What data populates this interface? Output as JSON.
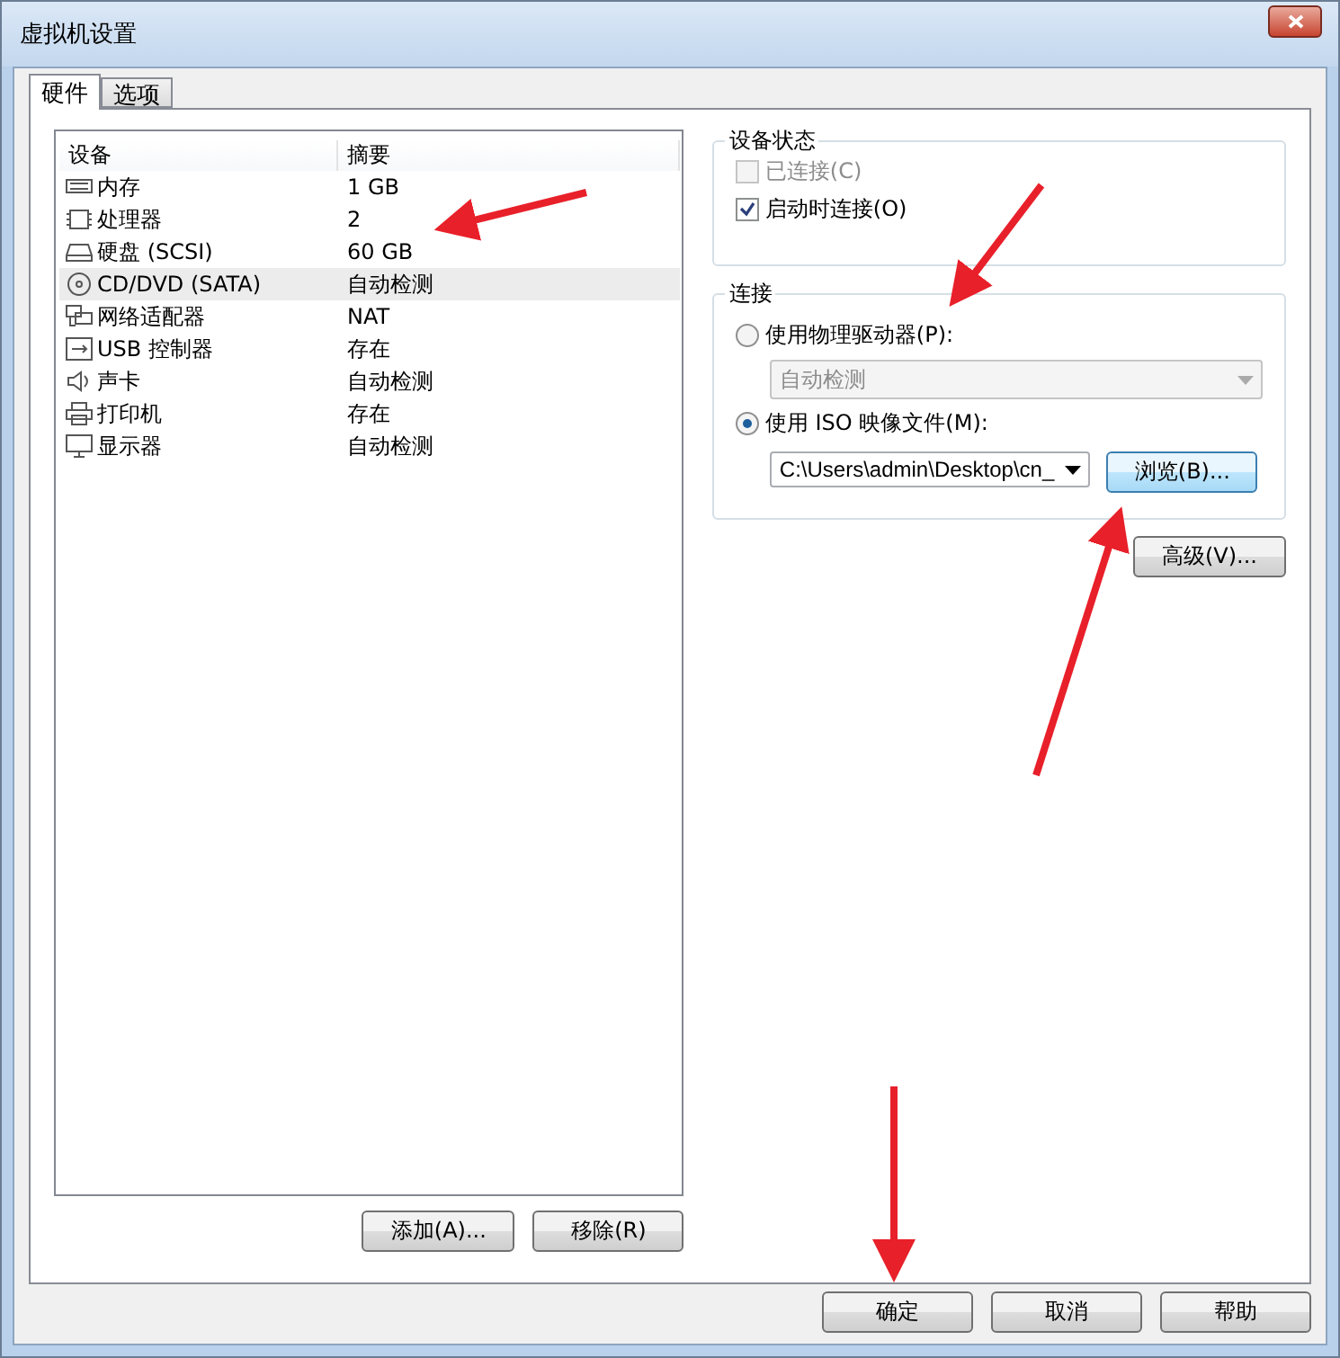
{
  "window": {
    "title": "虚拟机设置"
  },
  "tabs": [
    {
      "label": "硬件",
      "selected": true
    },
    {
      "label": "选项",
      "selected": false
    }
  ],
  "devices": {
    "columns": [
      "设备",
      "摘要"
    ],
    "rows": [
      {
        "kind": "memory",
        "name": "内存",
        "summary": "1 GB",
        "selected": false
      },
      {
        "kind": "cpu",
        "name": "处理器",
        "summary": "2",
        "selected": false
      },
      {
        "kind": "disk",
        "name": "硬盘 (SCSI)",
        "summary": "60 GB",
        "selected": false
      },
      {
        "kind": "cd",
        "name": "CD/DVD (SATA)",
        "summary": "自动检测",
        "selected": true
      },
      {
        "kind": "network",
        "name": "网络适配器",
        "summary": "NAT",
        "selected": false
      },
      {
        "kind": "usb",
        "name": "USB 控制器",
        "summary": "存在",
        "selected": false
      },
      {
        "kind": "sound",
        "name": "声卡",
        "summary": "自动检测",
        "selected": false
      },
      {
        "kind": "printer",
        "name": "打印机",
        "summary": "存在",
        "selected": false
      },
      {
        "kind": "display",
        "name": "显示器",
        "summary": "自动检测",
        "selected": false
      }
    ],
    "buttons": [
      "添加(A)...",
      "移除(R)"
    ]
  },
  "device_status": {
    "title": "设备状态",
    "checkboxes": [
      {
        "label": "已连接(C)",
        "checked": false,
        "disabled": true
      },
      {
        "label": "启动时连接(O)",
        "checked": true,
        "disabled": false
      }
    ]
  },
  "connection": {
    "title": "连接",
    "physical": {
      "label": "使用物理驱动器(P):",
      "selected": false,
      "value": "自动检测",
      "disabled": true
    },
    "iso": {
      "label": "使用 ISO 映像文件(M):",
      "selected": true,
      "value": "C:\\Users\\admin\\Desktop\\cn_",
      "button": "浏览(B)..."
    }
  },
  "advanced_button": "高级(V)...",
  "footer_buttons": [
    "确定",
    "取消",
    "帮助"
  ]
}
